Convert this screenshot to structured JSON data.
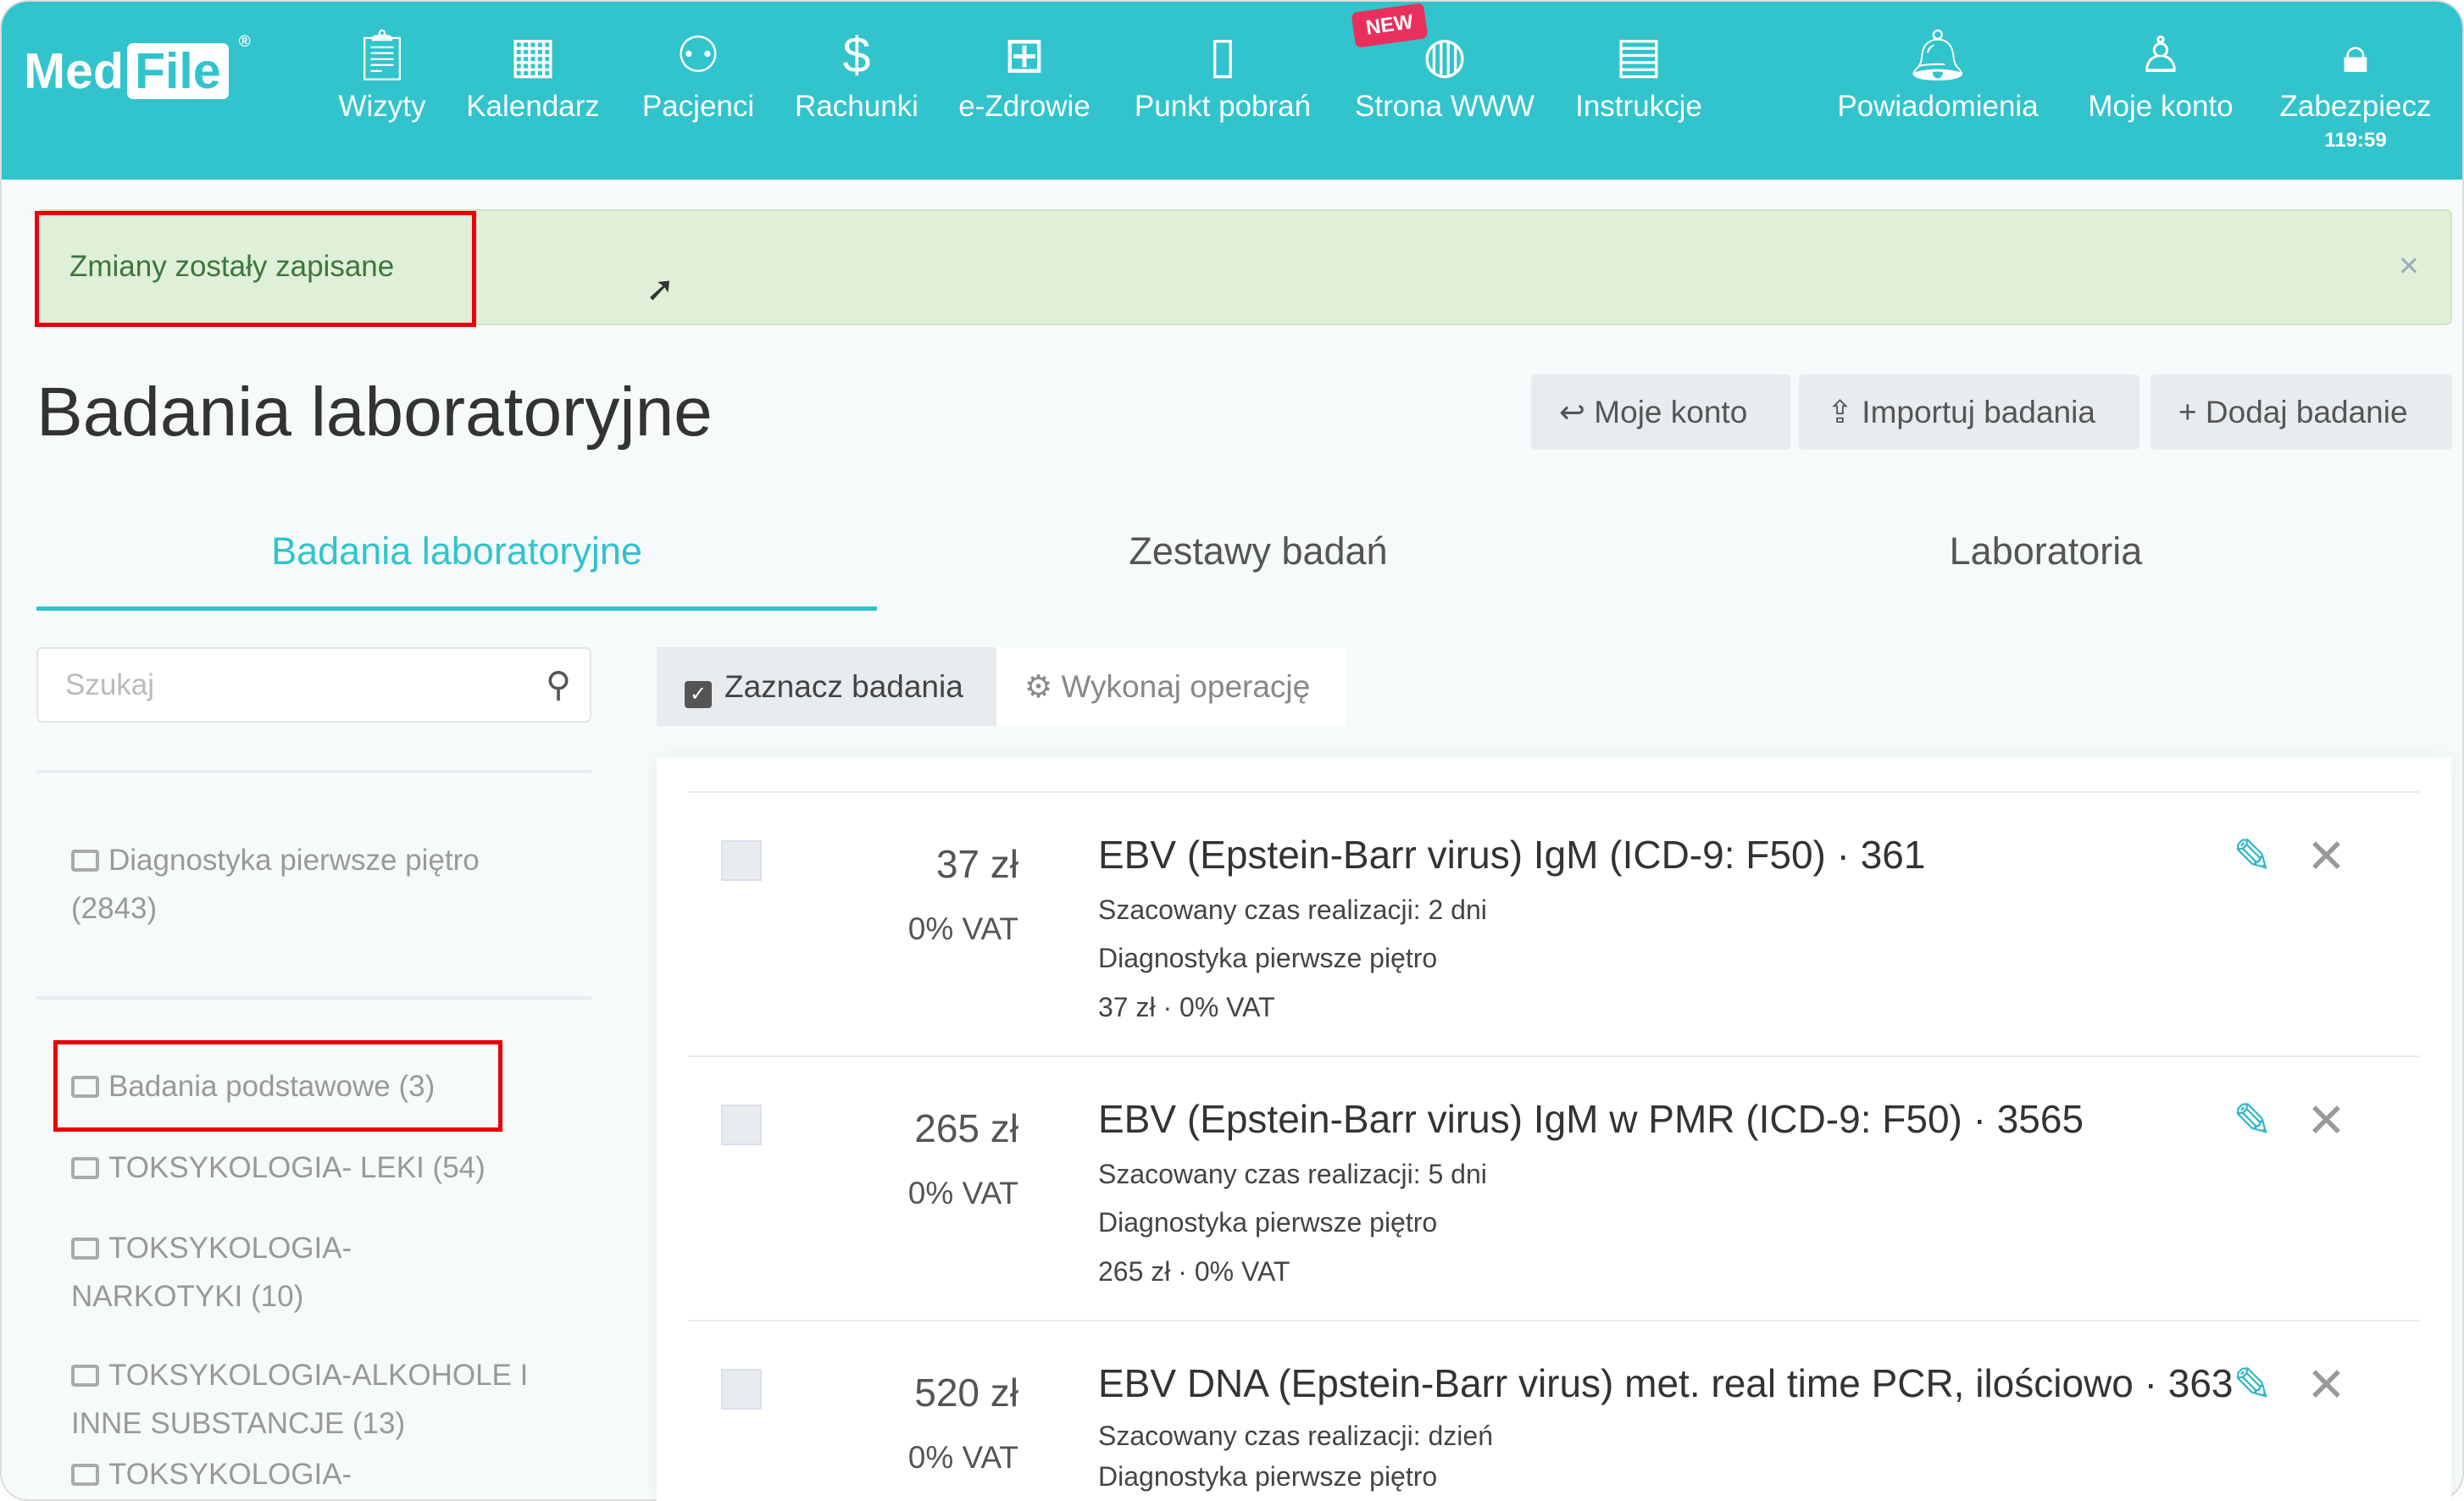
{
  "nav": {
    "logo": "MedFile",
    "items": [
      {
        "label": "Wizyty",
        "icon": "clipboard-icon"
      },
      {
        "label": "Kalendarz",
        "icon": "calendar-icon"
      },
      {
        "label": "Pacjenci",
        "icon": "users-icon"
      },
      {
        "label": "Rachunki",
        "icon": "dollar-icon"
      },
      {
        "label": "e-Zdrowie",
        "icon": "medical-cross-icon"
      },
      {
        "label": "Punkt pobrań",
        "icon": "document-icon"
      },
      {
        "label": "Strona WWW",
        "icon": "globe-icon"
      },
      {
        "label": "Instrukcje",
        "icon": "book-icon"
      },
      {
        "label": "Powiadomienia",
        "icon": "bell-icon"
      },
      {
        "label": "Moje konto",
        "icon": "user-icon"
      },
      {
        "label": "Zabezpiecz",
        "icon": "lock-icon"
      }
    ],
    "new_badge": "NEW",
    "timer": "119:59"
  },
  "alert": {
    "message": "Zmiany zostały zapisane",
    "close": "×"
  },
  "page": {
    "title": "Badania laboratoryjne",
    "buttons": {
      "account": "Moje konto",
      "import": "Importuj badania",
      "add": "Dodaj badanie"
    }
  },
  "tabs": [
    "Badania laboratoryjne",
    "Zestawy badań",
    "Laboratoria"
  ],
  "search": {
    "placeholder": "Szukaj",
    "value": ""
  },
  "toolbar": {
    "select": "Zaznacz badania",
    "operation": "Wykonaj operację"
  },
  "categories": [
    "Diagnostyka pierwsze piętro (2843)",
    "Badania podstawowe (3)",
    "TOKSYKOLOGIA- LEKI (54)",
    "TOKSYKOLOGIA- NARKOTYKI (10)",
    "TOKSYKOLOGIA-ALKOHOLE I INNE SUBSTANCJE (13)",
    "TOKSYKOLOGIA-"
  ],
  "tests": [
    {
      "price": "37 zł",
      "vat": "0% VAT",
      "title": "EBV (Epstein-Barr virus) IgM (ICD-9: F50) · 361",
      "time": "Szacowany czas realizacji: 2 dni",
      "location": "Diagnostyka pierwsze piętro",
      "summary": "37 zł · 0% VAT"
    },
    {
      "price": "265 zł",
      "vat": "0% VAT",
      "title": "EBV (Epstein-Barr virus) IgM w PMR (ICD-9: F50) · 3565",
      "time": "Szacowany czas realizacji: 5 dni",
      "location": "Diagnostyka pierwsze piętro",
      "summary": "265 zł · 0% VAT"
    },
    {
      "price": "520 zł",
      "vat": "0% VAT",
      "title": "EBV DNA (Epstein-Barr virus) met. real time PCR, ilościowo · 363",
      "time": "Szacowany czas realizacji: dzień",
      "location": "Diagnostyka pierwsze piętro",
      "summary": ""
    }
  ]
}
